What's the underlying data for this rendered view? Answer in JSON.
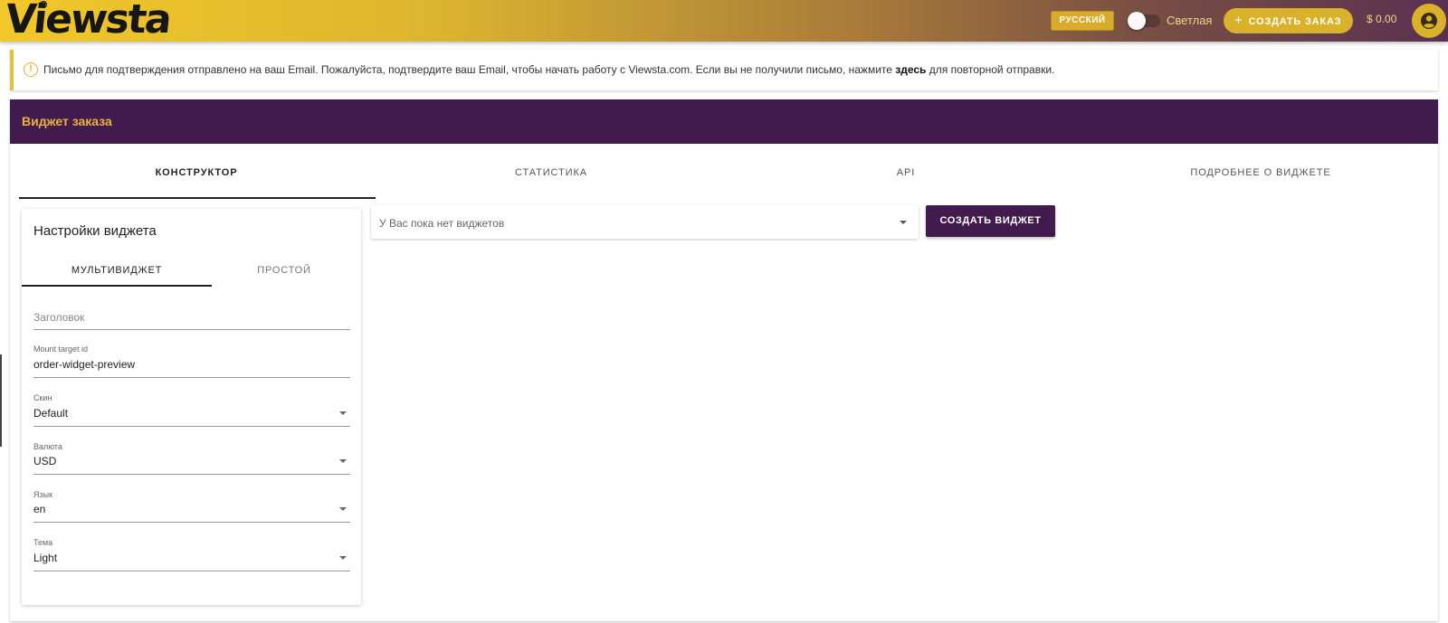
{
  "appbar": {
    "logo": "Viewsta",
    "language": "РУССКИЙ",
    "theme_label": "Светлая",
    "create_order": "СОЗДАТЬ ЗАКАЗ",
    "balance": "$ 0.00"
  },
  "banner": {
    "text_before": "Письмо для подтверждения отправлено на ваш Email. Пожалуйста, подтвердите ваш Email, чтобы начать работу с Viewsta.com. Если вы не получили письмо, нажмите ",
    "link": "здесь",
    "text_after": " для повторной отправки."
  },
  "card": {
    "title": "Виджет заказа",
    "tabs": [
      "КОНСТРУКТОР",
      "СТАТИСТИКА",
      "API",
      "ПОДРОБНЕЕ О ВИДЖЕТЕ"
    ],
    "active_tab": "КОНСТРУКТОР"
  },
  "settings": {
    "title": "Настройки виджета",
    "sub_tabs": [
      "МУЛЬТИВИДЖЕТ",
      "ПРОСТОЙ"
    ],
    "fields": {
      "heading": {
        "placeholder": "Заголовок"
      },
      "mount": {
        "label": "Mount target id",
        "value": "order-widget-preview"
      },
      "skin": {
        "label": "Скин",
        "value": "Default"
      },
      "currency": {
        "label": "Валюта",
        "value": "USD"
      },
      "language": {
        "label": "Язык",
        "value": "en"
      },
      "theme": {
        "label": "Тема",
        "value": "Light"
      }
    }
  },
  "widgets": {
    "select_placeholder": "У Вас пока нет виджетов",
    "create_button": "СОЗДАТЬ ВИДЖЕТ"
  },
  "colors": {
    "brand_purple": "#421b4e",
    "brand_gold": "#d9b12a",
    "title_gold": "#e8b43a"
  }
}
